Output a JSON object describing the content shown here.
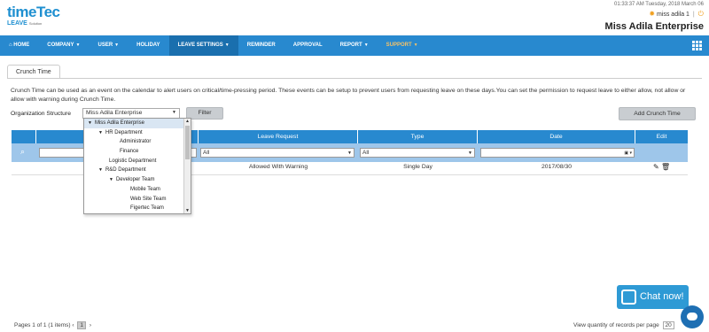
{
  "header": {
    "logo_time": "time",
    "logo_tec": "Tec",
    "logo_leave": "LEAVE",
    "logo_solution": "Solution",
    "datetime": "01:33:37 AM Tuesday, 2018 March 06",
    "user": "miss adila 1",
    "separator": "|",
    "company": "Miss Adila Enterprise"
  },
  "nav": {
    "items": [
      {
        "label": "HOME",
        "icon": "home-icon"
      },
      {
        "label": "COMPANY",
        "caret": true
      },
      {
        "label": "USER",
        "caret": true
      },
      {
        "label": "HOLIDAY"
      },
      {
        "label": "LEAVE SETTINGS",
        "caret": true,
        "active": true
      },
      {
        "label": "REMINDER"
      },
      {
        "label": "APPROVAL"
      },
      {
        "label": "REPORT",
        "caret": true
      },
      {
        "label": "SUPPORT",
        "caret": true
      }
    ]
  },
  "tab": {
    "label": "Crunch Time"
  },
  "description": "Crunch Time can be used as an event on the calendar to alert users on critical/time-pressing period. These events can be setup to prevent users from requesting leave on these days.You can set the permission to request leave to either allow, not allow or allow with warning during Crunch Time.",
  "filter_bar": {
    "org_label": "Organization Structure",
    "org_value": "Miss Adila Enterprise",
    "filter_button": "Filter",
    "add_button": "Add Crunch Time"
  },
  "table": {
    "headers": [
      "",
      "",
      "Leave Request",
      "Type",
      "Date",
      "Edit"
    ],
    "filters": {
      "leave_request": "All",
      "type": "All"
    },
    "rows": [
      {
        "leave_request": "Allowed With Warning",
        "type": "Single Day",
        "date": "2017/08/30"
      }
    ]
  },
  "tree": {
    "items": [
      {
        "label": "Miss Adila Enterprise",
        "level": 0,
        "expanded": true,
        "selected": true
      },
      {
        "label": "HR Department",
        "level": 1,
        "expanded": true
      },
      {
        "label": "Administrator",
        "level": 3
      },
      {
        "label": "Finance",
        "level": 3
      },
      {
        "label": "Logistic Department",
        "level": 2
      },
      {
        "label": "R&D Department",
        "level": 1,
        "expanded": true
      },
      {
        "label": "Developer Team",
        "level": 2,
        "expanded": true
      },
      {
        "label": "Mobile Team",
        "level": 4
      },
      {
        "label": "Web Site Team",
        "level": 4
      },
      {
        "label": "Figertec Team",
        "level": 4
      }
    ]
  },
  "footer": {
    "pages_text": "Pages 1 of 1 (1 items)",
    "prev": "‹",
    "current_page": "1",
    "next": "›",
    "qty_label": "View quantity of records per page",
    "qty_value": "20"
  },
  "chat": {
    "label": "Chat now!"
  }
}
